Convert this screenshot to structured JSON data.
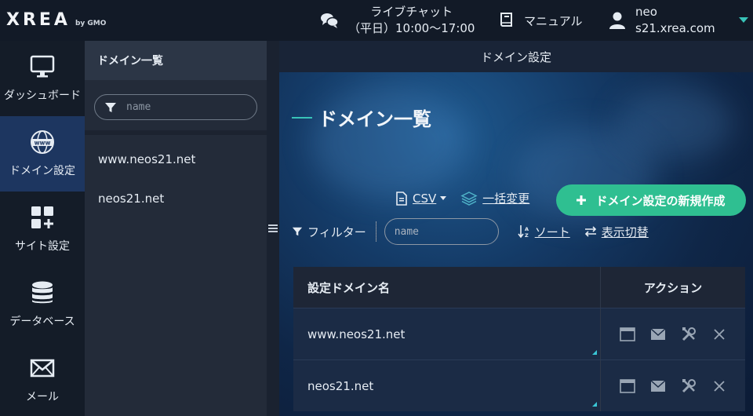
{
  "header": {
    "logo_main": "XREA",
    "logo_sub": "by GMO",
    "chat_title": "ライブチャット",
    "chat_hours": "（平日）10:00〜17:00",
    "manual": "マニュアル",
    "user_name": "neo",
    "user_server": "s21.xrea.com"
  },
  "leftnav": {
    "items": [
      {
        "label": "ダッシュボード",
        "icon": "monitor-icon"
      },
      {
        "label": "ドメイン設定",
        "icon": "www-globe-icon",
        "active": true
      },
      {
        "label": "サイト設定",
        "icon": "grid-plus-icon"
      },
      {
        "label": "データベース",
        "icon": "database-icon"
      },
      {
        "label": "メール",
        "icon": "mail-icon"
      }
    ]
  },
  "midpanel": {
    "title": "ドメイン一覧",
    "search_placeholder": "name",
    "domains": [
      "www.neos21.net",
      "neos21.net"
    ]
  },
  "main": {
    "header": "ドメイン設定",
    "page_title": "ドメイン一覧",
    "csv_label": "CSV",
    "bulk_label": "一括変更",
    "new_button": "ドメイン設定の新規作成",
    "filter_label": "フィルター",
    "filter_placeholder": "name",
    "sort_label": "ソート",
    "toggle_label": "表示切替",
    "table": {
      "col_domain": "設定ドメイン名",
      "col_action": "アクション",
      "rows": [
        "www.neos21.net",
        "neos21.net"
      ]
    }
  },
  "colors": {
    "accent": "#38c3b8",
    "button_green": "#2fbf91",
    "nav_active": "#1d3660"
  }
}
